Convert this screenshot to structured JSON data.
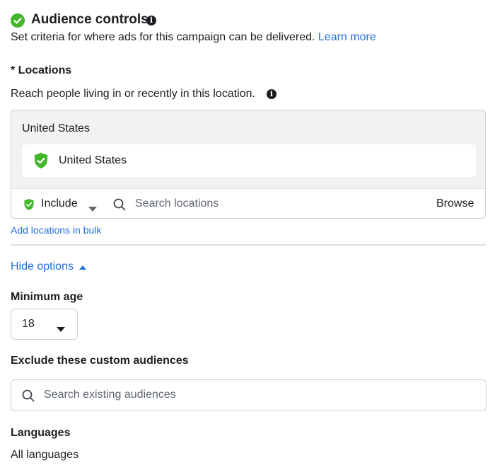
{
  "header": {
    "title": "Audience controls",
    "subtitle": "Set criteria for where ads for this campaign can be delivered.",
    "learn_more": "Learn more"
  },
  "locations": {
    "label": "* Locations",
    "description": "Reach people living in or recently in this location.",
    "group_header": "United States",
    "selected": [
      "United States"
    ],
    "mode": "Include",
    "search_placeholder": "Search locations",
    "browse_label": "Browse",
    "bulk_link": "Add locations in bulk"
  },
  "options_toggle": "Hide options",
  "minimum_age": {
    "label": "Minimum age",
    "value": "18"
  },
  "exclude_audiences": {
    "label": "Exclude these custom audiences",
    "placeholder": "Search existing audiences"
  },
  "languages": {
    "label": "Languages",
    "value": "All languages"
  },
  "colors": {
    "accent_link": "#216fdb",
    "success_green": "#42b72a",
    "border": "#ccd0d5"
  },
  "icons": [
    "check-circle-icon",
    "info-icon",
    "shield-check-icon",
    "chevron-down-icon",
    "search-icon",
    "caret-up-icon"
  ]
}
